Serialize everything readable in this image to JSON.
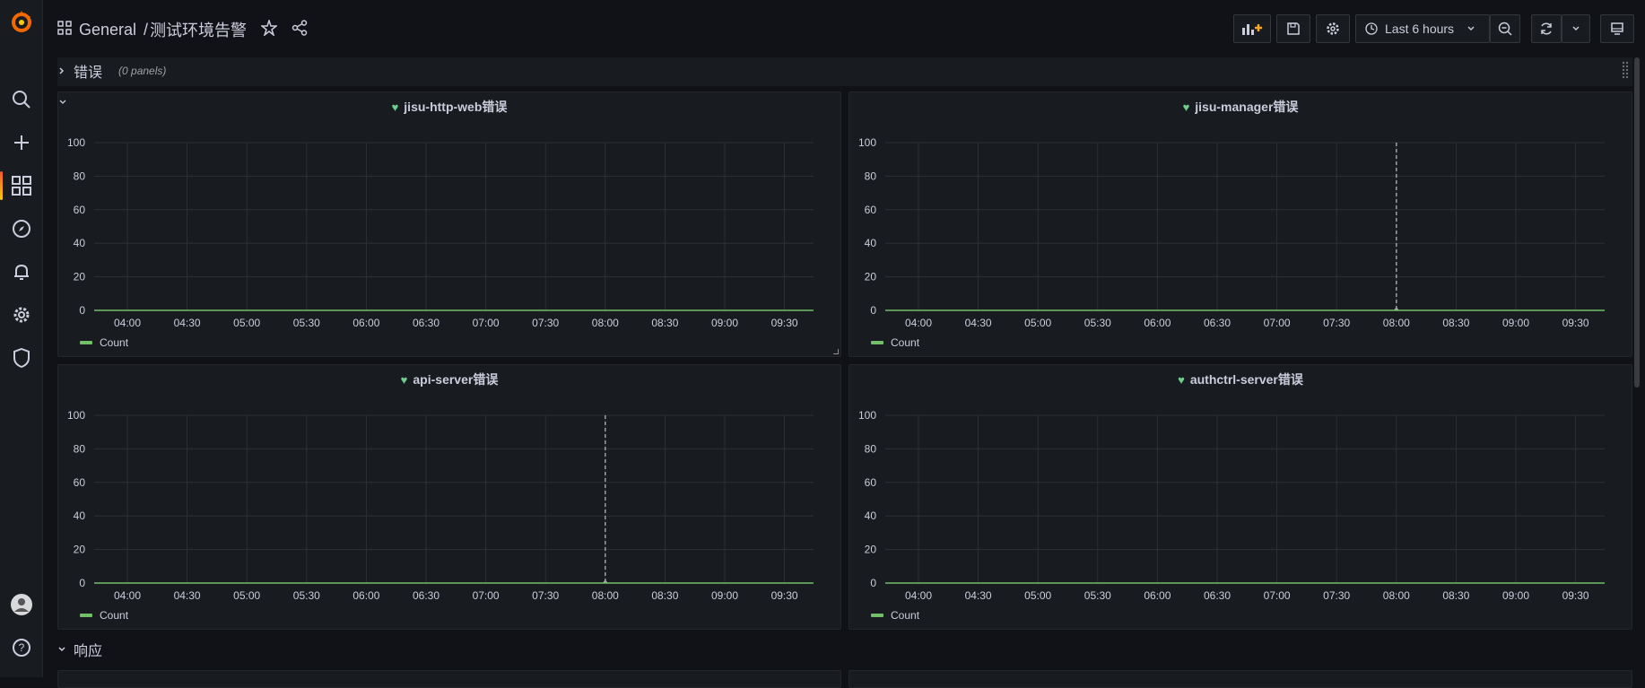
{
  "breadcrumb": {
    "folder": "General",
    "separator": "/",
    "dashboard": "测试环境告警"
  },
  "toolbar": {
    "time_range": "Last 6 hours"
  },
  "rows": [
    {
      "title": "错误",
      "hint": "(0 panels)"
    },
    {
      "title": "响应",
      "hint": ""
    }
  ],
  "panels": [
    {
      "title": "jisu-http-web错误",
      "has_menu": true,
      "marker": null
    },
    {
      "title": "jisu-manager错误",
      "has_menu": false,
      "marker": "08:00"
    },
    {
      "title": "api-server错误",
      "has_menu": false,
      "marker": "08:00"
    },
    {
      "title": "authctrl-server错误",
      "has_menu": false,
      "marker": null
    }
  ],
  "chart_data": [
    {
      "type": "line",
      "title": "jisu-http-web错误",
      "x": [
        "04:00",
        "04:30",
        "05:00",
        "05:30",
        "06:00",
        "06:30",
        "07:00",
        "07:30",
        "08:00",
        "08:30",
        "09:00",
        "09:30"
      ],
      "series": [
        {
          "name": "Count",
          "values": [
            0,
            0,
            0,
            0,
            0,
            0,
            0,
            0,
            0,
            0,
            0,
            0
          ]
        }
      ],
      "yticks": [
        "0",
        "20",
        "40",
        "60",
        "80",
        "100"
      ],
      "ylim": [
        0,
        100
      ],
      "grid": true,
      "legend": "bottom-left"
    },
    {
      "type": "line",
      "title": "jisu-manager错误",
      "x": [
        "04:00",
        "04:30",
        "05:00",
        "05:30",
        "06:00",
        "06:30",
        "07:00",
        "07:30",
        "08:00",
        "08:30",
        "09:00",
        "09:30"
      ],
      "series": [
        {
          "name": "Count",
          "values": [
            0,
            0,
            0,
            0,
            0,
            0,
            0,
            0,
            0,
            0,
            0,
            0
          ]
        }
      ],
      "yticks": [
        "0",
        "20",
        "40",
        "60",
        "80",
        "100"
      ],
      "ylim": [
        0,
        100
      ],
      "grid": true,
      "legend": "bottom-left"
    },
    {
      "type": "line",
      "title": "api-server错误",
      "x": [
        "04:00",
        "04:30",
        "05:00",
        "05:30",
        "06:00",
        "06:30",
        "07:00",
        "07:30",
        "08:00",
        "08:30",
        "09:00",
        "09:30"
      ],
      "series": [
        {
          "name": "Count",
          "values": [
            0,
            0,
            0,
            0,
            0,
            0,
            0,
            0,
            0,
            0,
            0,
            0
          ]
        }
      ],
      "yticks": [
        "0",
        "20",
        "40",
        "60",
        "80",
        "100"
      ],
      "ylim": [
        0,
        100
      ],
      "grid": true,
      "legend": "bottom-left"
    },
    {
      "type": "line",
      "title": "authctrl-server错误",
      "x": [
        "04:00",
        "04:30",
        "05:00",
        "05:30",
        "06:00",
        "06:30",
        "07:00",
        "07:30",
        "08:00",
        "08:30",
        "09:00",
        "09:30"
      ],
      "series": [
        {
          "name": "Count",
          "values": [
            0,
            0,
            0,
            0,
            0,
            0,
            0,
            0,
            0,
            0,
            0,
            0
          ]
        }
      ],
      "yticks": [
        "0",
        "20",
        "40",
        "60",
        "80",
        "100"
      ],
      "ylim": [
        0,
        100
      ],
      "grid": true,
      "legend": "bottom-left"
    }
  ],
  "colors": {
    "series": "#73bf69",
    "heart": "#6ccf8e",
    "grid": "#2c3035",
    "marker": "#9fa1a6"
  }
}
